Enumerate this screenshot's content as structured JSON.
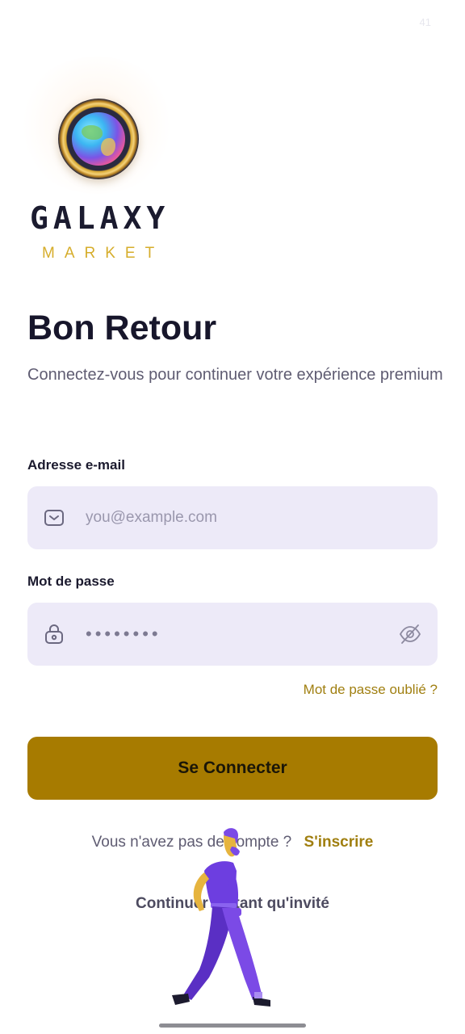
{
  "status": {
    "number": "41"
  },
  "brand": {
    "title": "GALAXY",
    "subtitle": "MARKET"
  },
  "page": {
    "heading": "Bon Retour",
    "subheading": "Connectez-vous pour continuer votre expérience premium"
  },
  "email": {
    "label": "Adresse e-mail",
    "placeholder": "you@example.com",
    "icon": "mail-icon"
  },
  "password": {
    "label": "Mot de passe",
    "value_masked": "••••••••",
    "icon": "lock-icon",
    "toggle_icon": "eye-off-icon"
  },
  "forgot": {
    "label": "Mot de passe oublié ?"
  },
  "submit": {
    "label": "Se Connecter"
  },
  "signup": {
    "prompt": "Vous n'avez pas de compte ?",
    "link": "S'inscrire"
  },
  "guest": {
    "label": "Continuer en tant qu'invité"
  },
  "colors": {
    "accent": "#a77b00",
    "gold_text": "#a07f10",
    "field_bg": "#edeaf8",
    "brand_gold": "#d6ad2b",
    "figure": "#6d3ee0"
  }
}
